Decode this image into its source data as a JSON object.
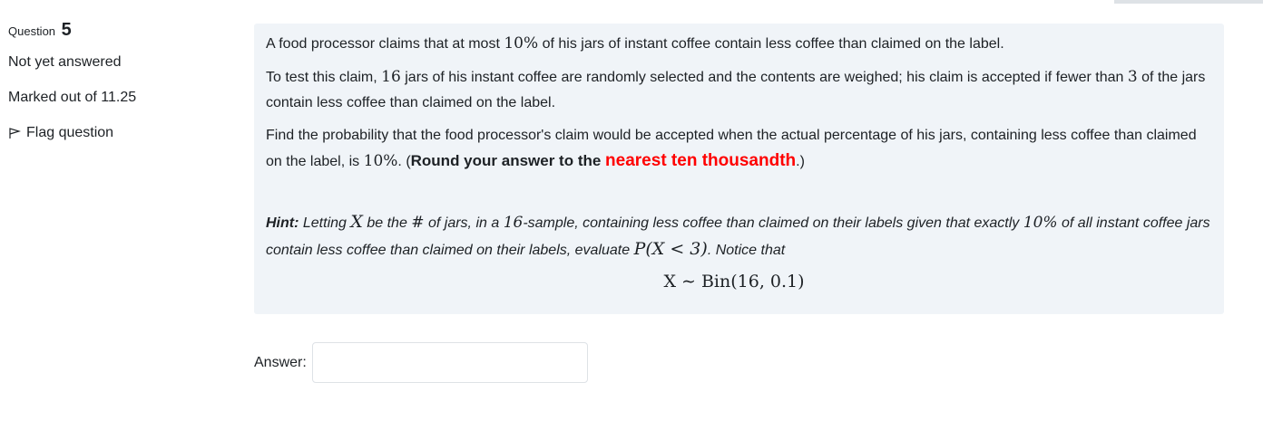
{
  "info": {
    "question_label": "Question",
    "question_number": "5",
    "state": "Not yet answered",
    "grade": "Marked out of 11.25",
    "flag_label": "Flag question"
  },
  "question": {
    "p1": {
      "a": "A food processor claims that at most ",
      "pct": "10%",
      "b": " of his jars of instant coffee contain less coffee than claimed on the label."
    },
    "p2": {
      "a": "To test this claim, ",
      "n": "16",
      "b": " jars of his instant coffee are randomly selected and the contents are weighed; his claim is accepted if fewer than ",
      "k": "3",
      "c": " of the jars contain less coffee than claimed on the label."
    },
    "p3": {
      "a": "Find the probability that the food processor's claim would be accepted when the actual percentage of his jars, containing less coffee than claimed on the label, is ",
      "pct": "10%",
      "b": ". (",
      "bold1": "Round your answer to the ",
      "red": "nearest ten thousandth",
      "c": ".)"
    },
    "hint": {
      "label": "Hint:",
      "a": " Letting ",
      "X": "X",
      "b": " be the ",
      "hash": "#",
      "c": " of jars, in a ",
      "n": "16",
      "d": "-sample, containing less coffee than claimed on their labels given that exactly ",
      "pct": "10%",
      "e": " of all instant coffee jars contain less coffee than claimed on their labels, evaluate ",
      "prob": "P(X < 3)",
      "f": ". Notice that"
    },
    "formula": "X ∼ Bin(16, 0.1)"
  },
  "answer": {
    "label": "Answer:",
    "value": ""
  }
}
